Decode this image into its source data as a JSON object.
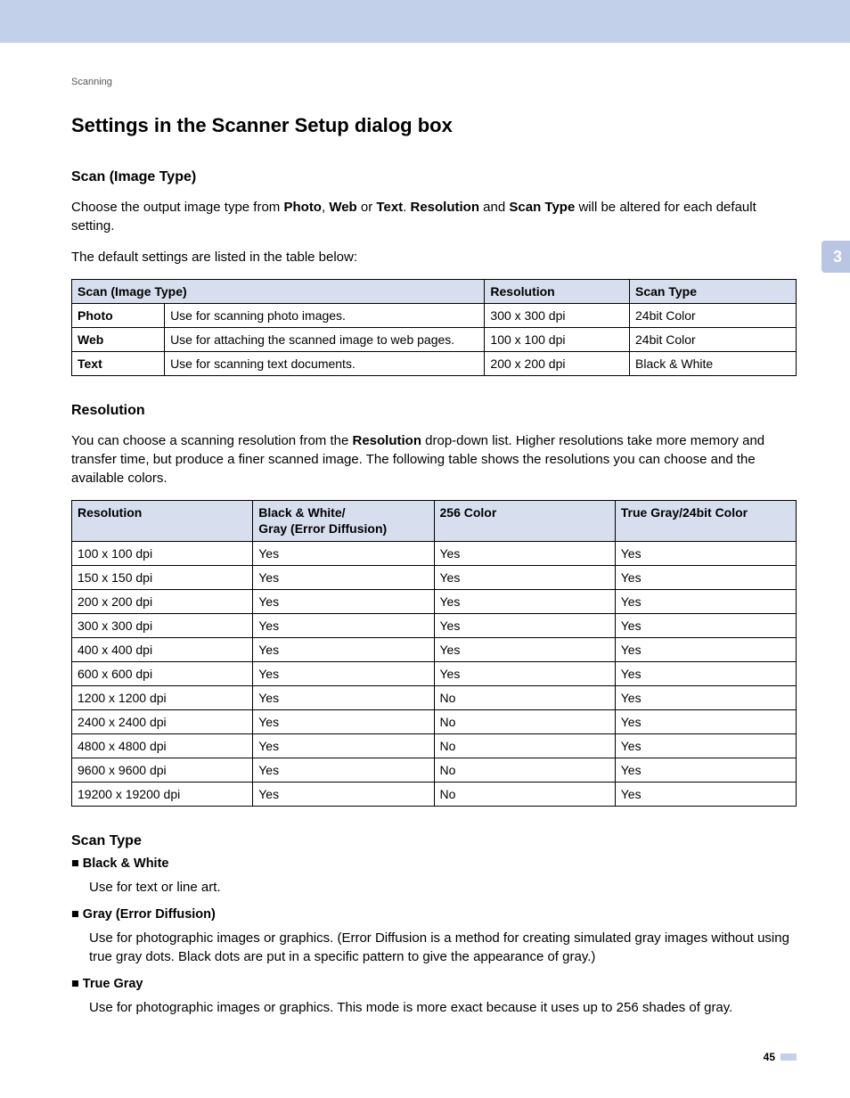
{
  "nav": {
    "tab_number": "3"
  },
  "breadcrumb": "Scanning",
  "title": "Settings in the Scanner Setup dialog box",
  "scan_image_type": {
    "heading": "Scan (Image Type)",
    "intro_1a": "Choose the output image type from ",
    "intro_1b": "Photo",
    "intro_1c": ", ",
    "intro_1d": "Web",
    "intro_1e": " or ",
    "intro_1f": "Text",
    "intro_1g": ". ",
    "intro_1h": "Resolution",
    "intro_1i": " and ",
    "intro_1j": "Scan Type",
    "intro_1k": " will be altered for each default setting.",
    "intro_2": "The default settings are listed in the table below:",
    "table": {
      "head": {
        "c1": "Scan (Image Type)",
        "c2": "Resolution",
        "c3": "Scan Type"
      },
      "rows": [
        {
          "name": "Photo",
          "desc": "Use for scanning photo images.",
          "res": "300 x 300 dpi",
          "type": "24bit Color"
        },
        {
          "name": "Web",
          "desc": "Use for attaching the scanned image to web pages.",
          "res": "100 x 100 dpi",
          "type": "24bit Color"
        },
        {
          "name": "Text",
          "desc": "Use for scanning text documents.",
          "res": "200 x 200 dpi",
          "type": "Black & White"
        }
      ]
    }
  },
  "resolution": {
    "heading": "Resolution",
    "intro_a": "You can choose a scanning resolution from the ",
    "intro_b": "Resolution",
    "intro_c": " drop-down list. Higher resolutions take more memory and transfer time, but produce a finer scanned image. The following table shows the resolutions you can choose and the available colors.",
    "table": {
      "head": {
        "c1": "Resolution",
        "c2a": "Black & White/",
        "c2b": "Gray (Error Diffusion)",
        "c3": "256 Color",
        "c4": "True Gray/24bit Color"
      },
      "rows": [
        {
          "r": "100 x 100 dpi",
          "bw": "Yes",
          "c256": "Yes",
          "tg": "Yes"
        },
        {
          "r": "150 x 150 dpi",
          "bw": "Yes",
          "c256": "Yes",
          "tg": "Yes"
        },
        {
          "r": "200 x 200 dpi",
          "bw": "Yes",
          "c256": "Yes",
          "tg": "Yes"
        },
        {
          "r": "300 x 300 dpi",
          "bw": "Yes",
          "c256": "Yes",
          "tg": "Yes"
        },
        {
          "r": "400 x 400 dpi",
          "bw": "Yes",
          "c256": "Yes",
          "tg": "Yes"
        },
        {
          "r": "600 x 600 dpi",
          "bw": "Yes",
          "c256": "Yes",
          "tg": "Yes"
        },
        {
          "r": "1200 x 1200 dpi",
          "bw": "Yes",
          "c256": "No",
          "tg": "Yes"
        },
        {
          "r": "2400 x 2400 dpi",
          "bw": "Yes",
          "c256": "No",
          "tg": "Yes"
        },
        {
          "r": "4800 x 4800 dpi",
          "bw": "Yes",
          "c256": "No",
          "tg": "Yes"
        },
        {
          "r": "9600 x 9600 dpi",
          "bw": "Yes",
          "c256": "No",
          "tg": "Yes"
        },
        {
          "r": "19200 x 19200 dpi",
          "bw": "Yes",
          "c256": "No",
          "tg": "Yes"
        }
      ]
    }
  },
  "scan_type": {
    "heading": "Scan Type",
    "items": [
      {
        "label": "Black & White",
        "desc": "Use for text or line art."
      },
      {
        "label": "Gray (Error Diffusion)",
        "desc": "Use for photographic images or graphics. (Error Diffusion is a method for creating simulated gray images without using true gray dots. Black dots are put in a specific pattern to give the appearance of gray.)"
      },
      {
        "label": "True Gray",
        "desc": "Use for photographic images or graphics. This mode is more exact because it uses up to 256 shades of gray."
      }
    ]
  },
  "page_number": "45"
}
